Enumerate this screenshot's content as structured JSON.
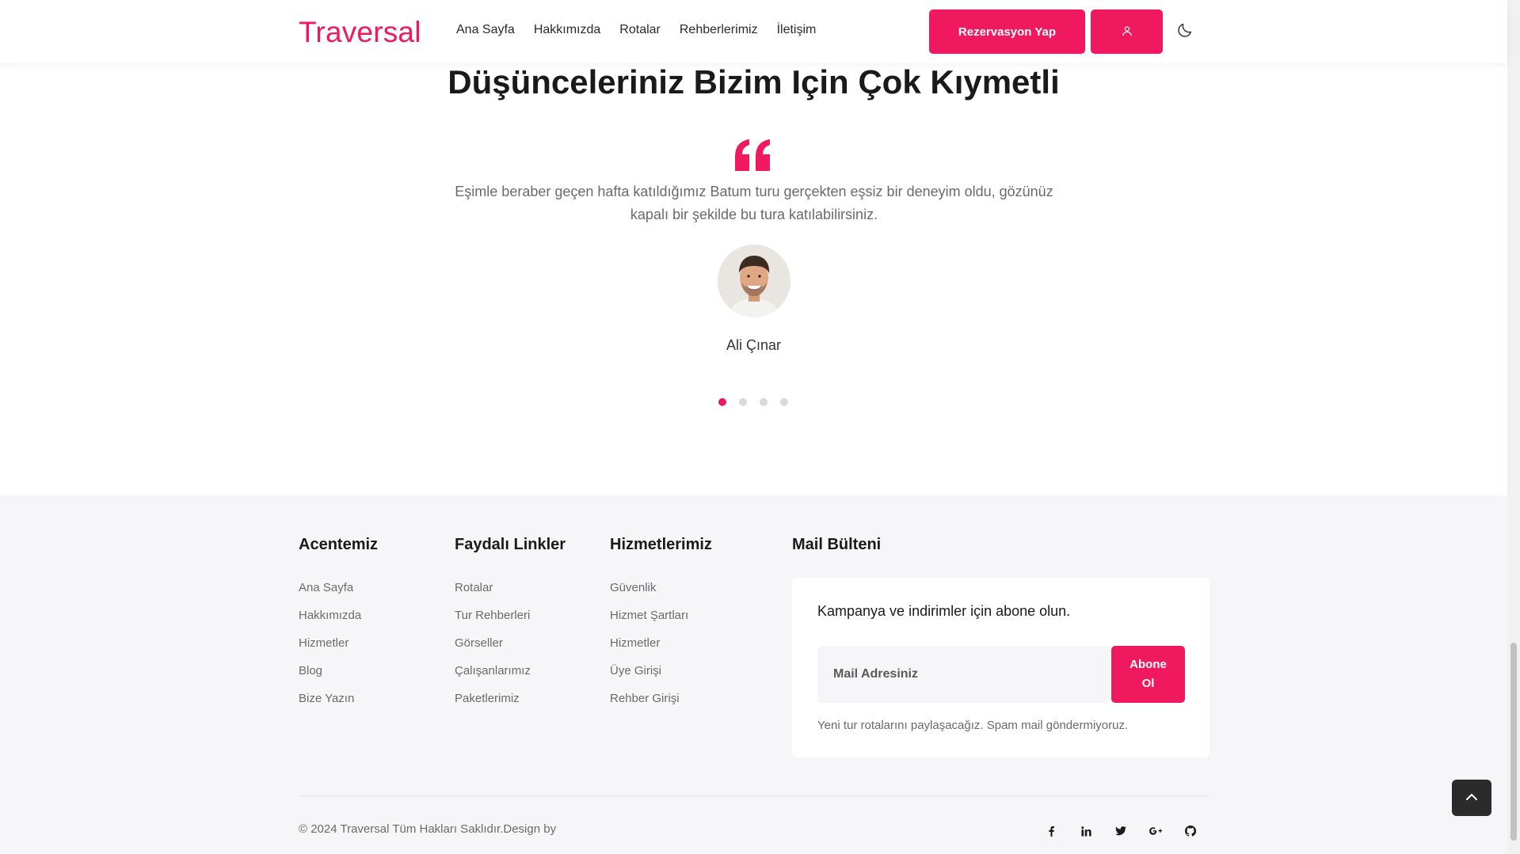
{
  "header": {
    "logo": "Traversal",
    "nav": [
      "Ana Sayfa",
      "Hakkımızda",
      "Rotalar",
      "Rehberlerimiz",
      "İletişim"
    ],
    "reserve_label": "Rezervasyon Yap",
    "user_icon": "user-icon",
    "theme_icon": "moon-icon"
  },
  "testimonials": {
    "title": "Düşünceleriniz Bizim Için Çok Kıymetli",
    "quote_icon": "quote-icon",
    "text": "Eşimle beraber geçen hafta katıldığımız Batum turu gerçekten eşsiz bir deneyim oldu, gözünüz kapalı bir şekilde bu tura katılabilirsiniz.",
    "author": "Ali Çınar",
    "slide_count": 4,
    "active_slide": 1
  },
  "footer": {
    "columns": [
      {
        "title": "Acentemiz",
        "links": [
          "Ana Sayfa",
          "Hakkımızda",
          "Hizmetler",
          "Blog",
          "Bize Yazın"
        ]
      },
      {
        "title": "Faydalı Linkler",
        "links": [
          "Rotalar",
          "Tur Rehberleri",
          "Görseller",
          "Çalışanlarımız",
          "Paketlerimiz"
        ]
      },
      {
        "title": "Hizmetlerimiz",
        "links": [
          "Güvenlik",
          "Hizmet Şartları",
          "Hizmetler",
          "Üye Girişi",
          "Rehber Girişi"
        ]
      }
    ],
    "newsletter": {
      "title": "Mail Bülteni",
      "text": "Kampanya ve indirimler için abone olun.",
      "placeholder": "Mail Adresiniz",
      "button": "Abone Ol",
      "note": "Yeni tur rotalarını paylaşacağız. Spam mail göndermiyoruz."
    },
    "copyright": "© 2024 Traversal Tüm Hakları Saklıdır.Design by",
    "socials": [
      "facebook-icon",
      "linkedin-icon",
      "twitter-icon",
      "google-plus-icon",
      "github-icon"
    ]
  },
  "colors": {
    "accent": "#f0185e",
    "footer_bg": "#f6f6f8"
  }
}
